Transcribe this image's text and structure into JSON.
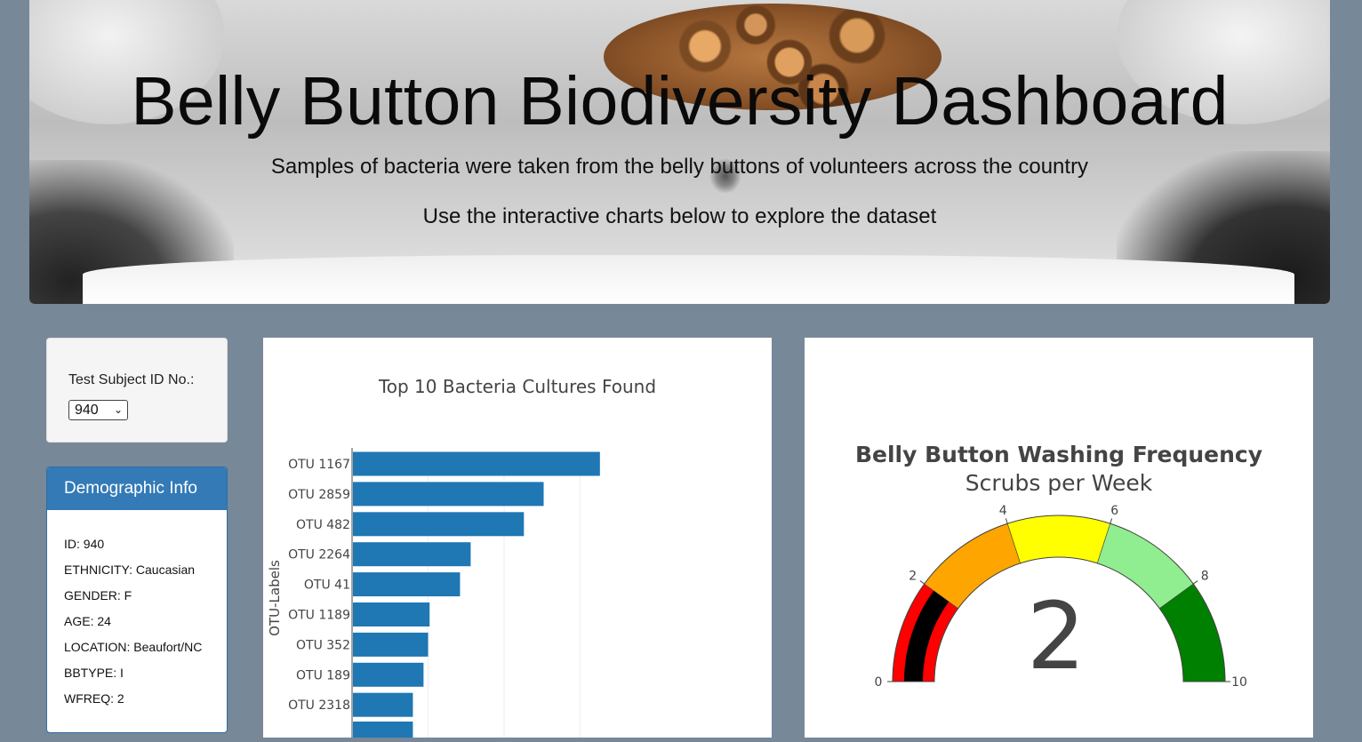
{
  "header": {
    "title": "Belly Button Biodiversity Dashboard",
    "subtitle1": "Samples of bacteria were taken from the belly buttons of volunteers across the country",
    "subtitle2": "Use the interactive charts below to explore the dataset"
  },
  "selector": {
    "label": "Test Subject ID No.:",
    "selected": "940"
  },
  "demographics": {
    "title": "Demographic Info",
    "items": [
      "ID: 940",
      "ETHNICITY: Caucasian",
      "GENDER: F",
      "AGE: 24",
      "LOCATION: Beaufort/NC",
      "BBTYPE: I",
      "WFREQ: 2"
    ]
  },
  "chart_data": [
    {
      "type": "bar",
      "orientation": "horizontal",
      "title": "Top 10 Bacteria Cultures Found",
      "ylabel": "OTU-Labels",
      "xlabel": "",
      "categories": [
        "OTU 1167",
        "OTU 2859",
        "OTU 482",
        "OTU 2264",
        "OTU 41",
        "OTU 1189",
        "OTU 352",
        "OTU 189",
        "OTU 2318"
      ],
      "values": [
        163,
        126,
        113,
        78,
        71,
        51,
        50,
        47,
        40
      ],
      "xlim": [
        0,
        190
      ],
      "grid": true,
      "color": "#1f77b4"
    },
    {
      "type": "gauge",
      "title": "Belly Button Washing Frequency",
      "subtitle": "Scrubs per Week",
      "value": 2,
      "range": [
        0,
        10
      ],
      "ticks": [
        "0",
        "2",
        "4",
        "6",
        "8",
        "10"
      ],
      "tick_values": [
        0,
        2,
        4,
        6,
        8,
        10
      ],
      "steps": [
        {
          "range": [
            0,
            2
          ],
          "color": "#ff0000"
        },
        {
          "range": [
            2,
            4
          ],
          "color": "#ffa500"
        },
        {
          "range": [
            4,
            6
          ],
          "color": "#ffff00"
        },
        {
          "range": [
            6,
            8
          ],
          "color": "#90ee90"
        },
        {
          "range": [
            8,
            10
          ],
          "color": "#008000"
        }
      ],
      "bar_color": "#000000"
    }
  ]
}
